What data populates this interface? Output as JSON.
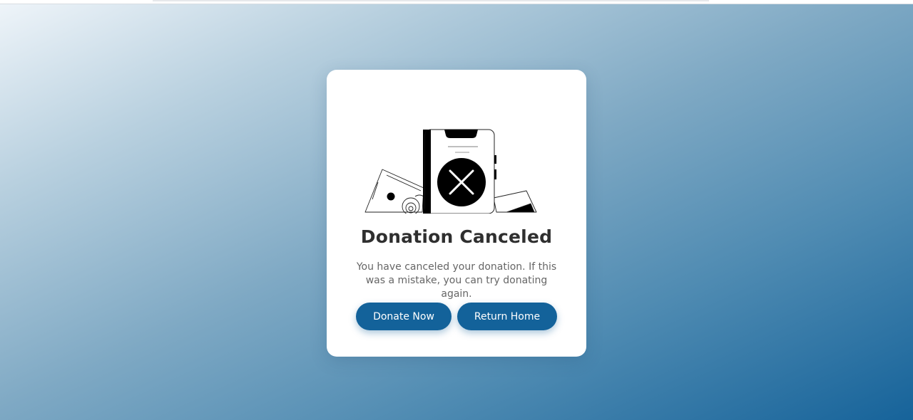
{
  "card": {
    "title": "Donation Canceled",
    "message": "You have canceled your donation. If this was a mistake, you can try donating again.",
    "illustration_icon": "phone-cancel-icon"
  },
  "actions": {
    "donate_label": "Donate Now",
    "home_label": "Return Home"
  },
  "colors": {
    "button": "#13629a",
    "gradient_start": "#eef4f9",
    "gradient_end": "#16639a",
    "title": "#2f2f2f",
    "message": "#666666"
  }
}
